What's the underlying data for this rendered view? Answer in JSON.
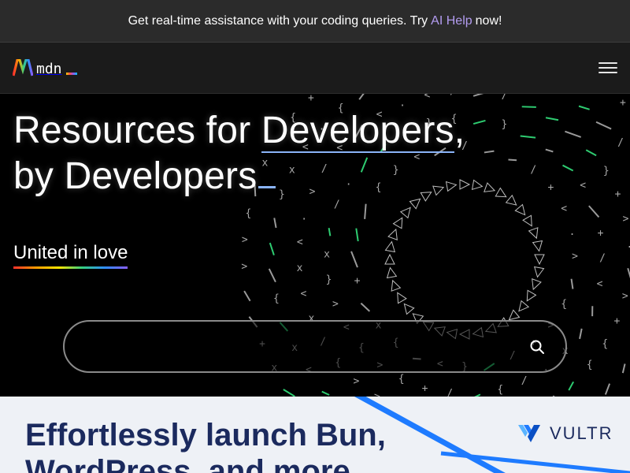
{
  "banner": {
    "text_before": "Get real-time assistance with your coding queries. Try",
    "link_text": "AI Help",
    "text_after": "now!"
  },
  "nav": {
    "logo_text": "mdn",
    "menu_icon": "hamburger-menu-icon"
  },
  "hero": {
    "title_line1_prefix": "Resources for ",
    "title_line1_highlight": "Developers",
    "title_line1_suffix": ",",
    "title_line2": "by Developers",
    "tagline": "United in love"
  },
  "search": {
    "value": "",
    "placeholder": "",
    "icon": "search-icon"
  },
  "ad": {
    "headline": "Effortlessly launch Bun, WordPress, and more",
    "brand": "VULTR"
  },
  "colors": {
    "banner_bg": "#2b2b2b",
    "nav_bg": "#1b1b1b",
    "link_purple": "#b39cf0",
    "highlight_blue": "#8ab4f8",
    "art_green": "#2ecc71",
    "ad_navy": "#1b2a5e",
    "ad_blue": "#1e7bff"
  }
}
